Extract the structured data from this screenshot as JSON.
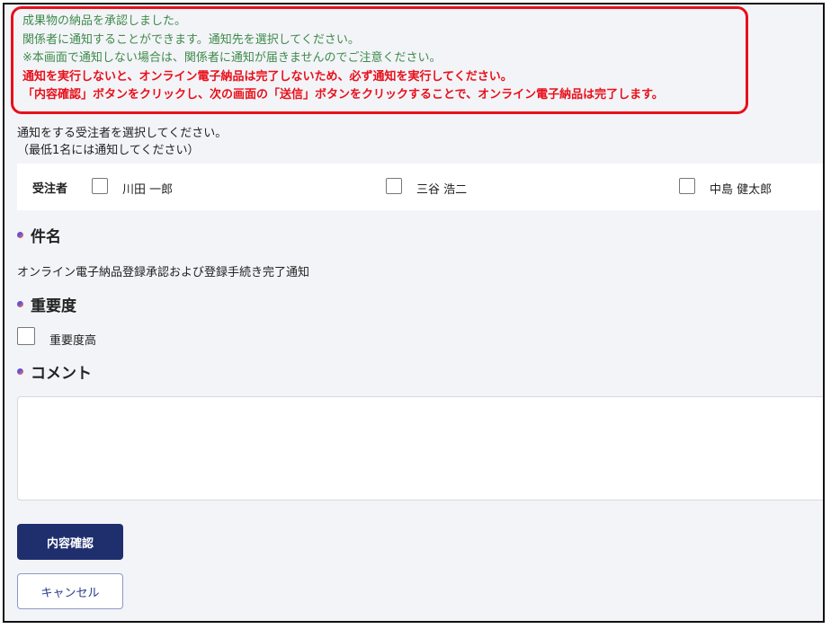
{
  "notice": {
    "lines": [
      "成果物の納品を承認しました。",
      "関係者に通知することができます。通知先を選択してください。",
      "※本画面で通知しない場合は、関係者に通知が届きませんのでご注意ください。",
      "通知を実行しないと、オンライン電子納品は完了しないため、必ず通知を実行してください。",
      "「内容確認」ボタンをクリックし、次の画面の「送信」ボタンをクリックすることで、オンライン電子納品は完了します。"
    ]
  },
  "instruction": {
    "line1": "通知をする受注者を選択してください。",
    "line2": "（最低1名には通知してください）"
  },
  "recipients": {
    "label": "受注者",
    "items": [
      {
        "name": "川田 一郎",
        "checked": false
      },
      {
        "name": "三谷 浩二",
        "checked": false
      },
      {
        "name": "中島 健太郎",
        "checked": false
      }
    ]
  },
  "subject": {
    "heading": "件名",
    "value": "オンライン電子納品登録承認および登録手続き完了通知"
  },
  "importance": {
    "heading": "重要度",
    "option_label": "重要度高",
    "checked": false
  },
  "comment": {
    "heading": "コメント",
    "value": ""
  },
  "buttons": {
    "confirm_label": "内容確認",
    "cancel_label": "キャンセル"
  },
  "colors": {
    "alert_red": "#e8101a",
    "notice_green": "#3e8a4a",
    "primary_navy": "#1f2f6e"
  }
}
